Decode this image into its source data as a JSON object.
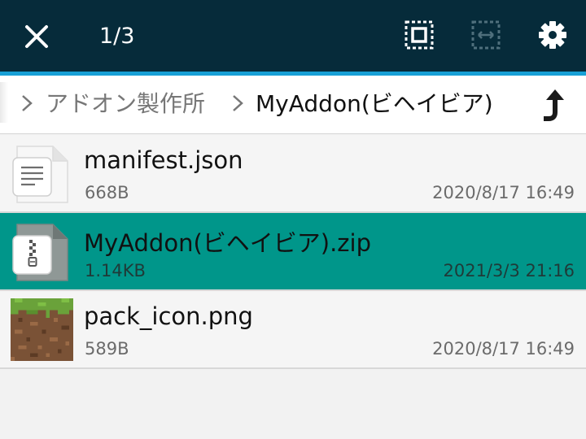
{
  "toolbar": {
    "counter": "1/3",
    "icons": {
      "close": "close-icon",
      "select_all": "select-all-icon",
      "select_range": "select-range-icon",
      "settings": "gear-icon"
    }
  },
  "breadcrumb": {
    "parent": "アドオン製作所",
    "current": "MyAddon(ビヘイビア)",
    "up_icon": "up-directory-icon"
  },
  "files": [
    {
      "name": "manifest.json",
      "size": "668B",
      "date": "2020/8/17 16:49",
      "icon": "text-document-icon",
      "selected": false
    },
    {
      "name": "MyAddon(ビヘイビア).zip",
      "size": "1.14KB",
      "date": "2021/3/3 21:16",
      "icon": "zip-archive-icon",
      "selected": true
    },
    {
      "name": "pack_icon.png",
      "size": "589B",
      "date": "2020/8/17 16:49",
      "icon": "image-thumbnail-icon",
      "selected": false
    }
  ],
  "colors": {
    "toolbar_bg": "#062b3a",
    "toolbar_accent": "#18a0d6",
    "selected_row": "#00968a",
    "row_bg": "#f5f5f5"
  }
}
